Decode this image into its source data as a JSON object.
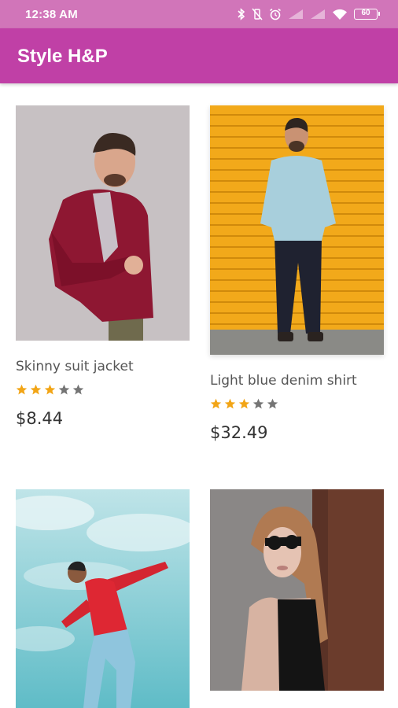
{
  "status_bar": {
    "time": "12:38 AM",
    "battery": "60"
  },
  "app_bar": {
    "title": "Style H&P"
  },
  "colors": {
    "status_bar": "#d175b9",
    "app_bar": "#c040a6",
    "star_filled": "#f2a516",
    "star_empty": "#757575"
  },
  "products": [
    {
      "name": "Skinny suit jacket",
      "rating": 3,
      "max_rating": 5,
      "price": "$8.44",
      "image": "man-red-blazer-photo"
    },
    {
      "name": "Light blue denim shirt",
      "rating": 3,
      "max_rating": 5,
      "price": "$32.49",
      "image": "man-denim-shirt-photo"
    },
    {
      "name": "",
      "rating": null,
      "price": "",
      "image": "man-red-hoodie-sky-photo"
    },
    {
      "name": "",
      "rating": null,
      "price": "",
      "image": "woman-black-top-sunglasses-photo"
    }
  ]
}
